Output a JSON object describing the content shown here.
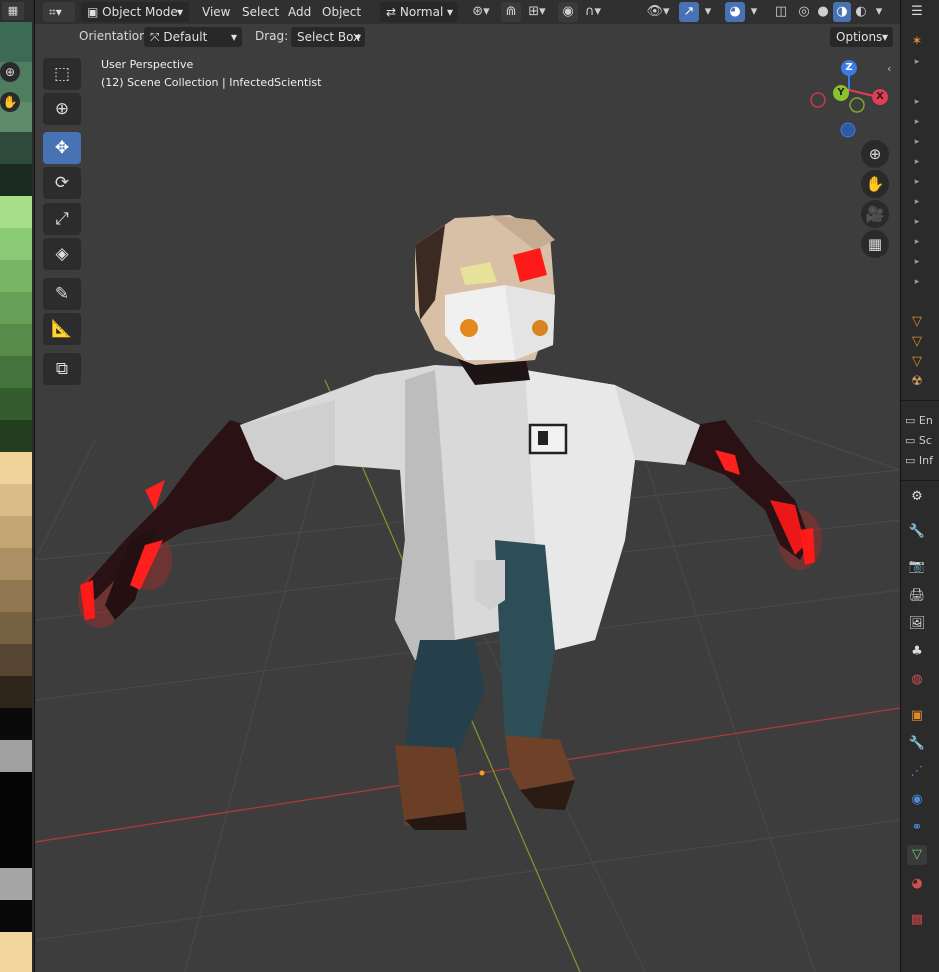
{
  "header": {
    "mode": "Object Mode",
    "menus": [
      "View",
      "Select",
      "Add",
      "Object"
    ],
    "transform_orientation": "Normal",
    "options_label": "Options"
  },
  "subheader": {
    "orientation_label": "Orientation:",
    "orientation_value": "Default",
    "drag_label": "Drag:",
    "drag_value": "Select Box"
  },
  "viewport": {
    "perspective": "User Perspective",
    "collection": "(12) Scene Collection | InfectedScientist"
  },
  "gizmo": {
    "x": "X",
    "y": "Y",
    "z": "Z"
  },
  "outliner_partial": [
    "En",
    "Sc",
    "Inf"
  ],
  "colors": {
    "active_tool": "#4772b3",
    "axis_x": "#e23d53",
    "axis_y": "#8bc22c",
    "axis_z": "#3a7be6",
    "glow_red": "#ff1a1a"
  }
}
